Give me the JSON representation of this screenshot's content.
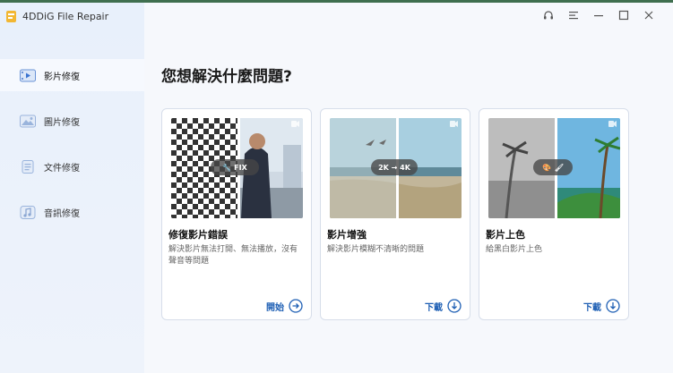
{
  "app": {
    "title": "4DDiG File Repair"
  },
  "window_controls": [
    "headset-icon",
    "menu-icon",
    "minimize-icon",
    "maximize-icon",
    "close-icon"
  ],
  "sidebar": {
    "items": [
      {
        "label": "影片修復",
        "icon": "video-icon",
        "active": true
      },
      {
        "label": "圖片修復",
        "icon": "image-icon",
        "active": false
      },
      {
        "label": "文件修復",
        "icon": "document-icon",
        "active": false
      },
      {
        "label": "音訊修復",
        "icon": "audio-icon",
        "active": false
      }
    ]
  },
  "main": {
    "heading": "您想解決什麼問題?",
    "cards": [
      {
        "title": "修復影片錯誤",
        "desc": "解決影片無法打開、無法播放，沒有聲音等問題",
        "action": "開始",
        "action_icon": "arrow-right-circle-icon",
        "badge": "FIX"
      },
      {
        "title": "影片增強",
        "desc": "解決影片模糊不清晰的問題",
        "action": "下載",
        "action_icon": "download-circle-icon",
        "badge": "2K → 4K"
      },
      {
        "title": "影片上色",
        "desc": "給黑白影片上色",
        "action": "下載",
        "action_icon": "download-circle-icon",
        "badge": "palette-brush"
      }
    ]
  },
  "colors": {
    "accent": "#1e5fb4",
    "sidebar_bg": "#e8f0fb",
    "main_bg": "#f6f8fc"
  }
}
